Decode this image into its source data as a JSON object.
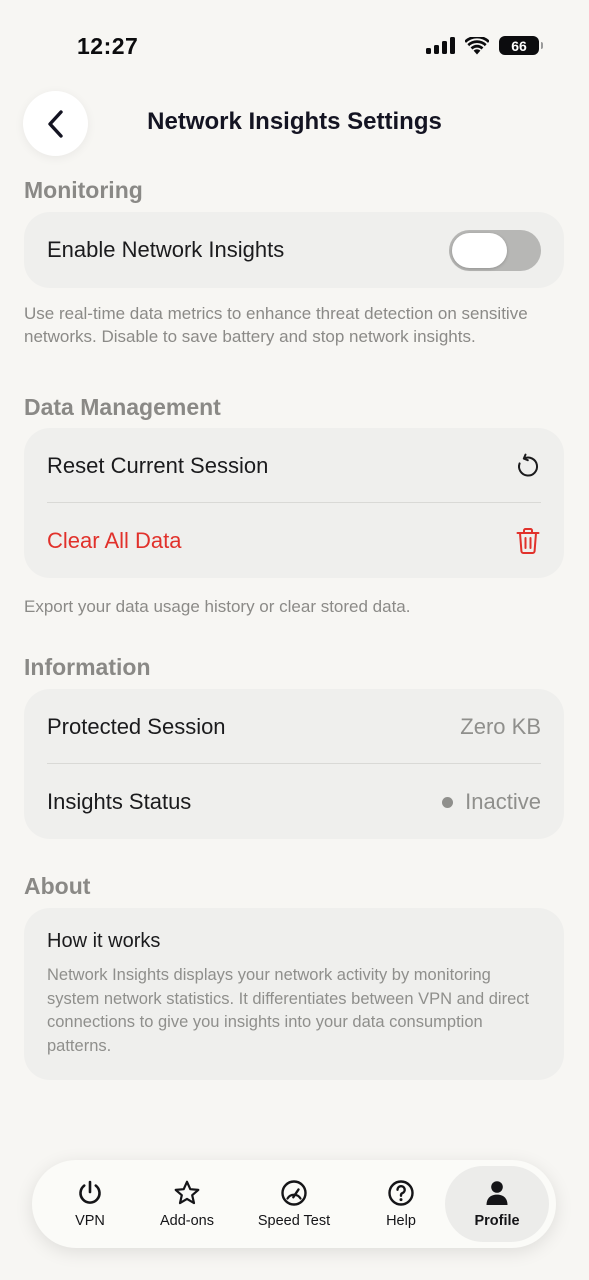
{
  "status_bar": {
    "time": "12:27",
    "battery": "66"
  },
  "header": {
    "title": "Network Insights Settings"
  },
  "monitoring": {
    "section_title": "Monitoring",
    "toggle_label": "Enable Network Insights",
    "toggle_on": false,
    "description": "Use real-time data metrics to enhance threat detection on sensitive networks. Disable to save battery and stop network insights."
  },
  "data_management": {
    "section_title": "Data Management",
    "reset_label": "Reset Current Session",
    "clear_label": "Clear All Data",
    "description": "Export your data usage history or clear stored data."
  },
  "information": {
    "section_title": "Information",
    "protected_label": "Protected Session",
    "protected_value": "Zero KB",
    "status_label": "Insights Status",
    "status_value": "Inactive"
  },
  "about": {
    "section_title": "About",
    "card_title": "How it works",
    "card_text": "Network Insights displays your network activity by monitoring system network statistics. It differentiates between VPN and direct connections to give you insights into your data consumption patterns."
  },
  "tabs": [
    {
      "label": "VPN",
      "icon": "power-icon",
      "active": false
    },
    {
      "label": "Add-ons",
      "icon": "star-icon",
      "active": false
    },
    {
      "label": "Speed Test",
      "icon": "speedometer-icon",
      "active": false
    },
    {
      "label": "Help",
      "icon": "help-circle-icon",
      "active": false
    },
    {
      "label": "Profile",
      "icon": "person-icon",
      "active": true
    }
  ],
  "colors": {
    "background": "#f7f6f3",
    "card": "#efefed",
    "danger": "#e1312b",
    "muted": "#8f8f8c",
    "toggle_off": "#b7b7b5"
  }
}
